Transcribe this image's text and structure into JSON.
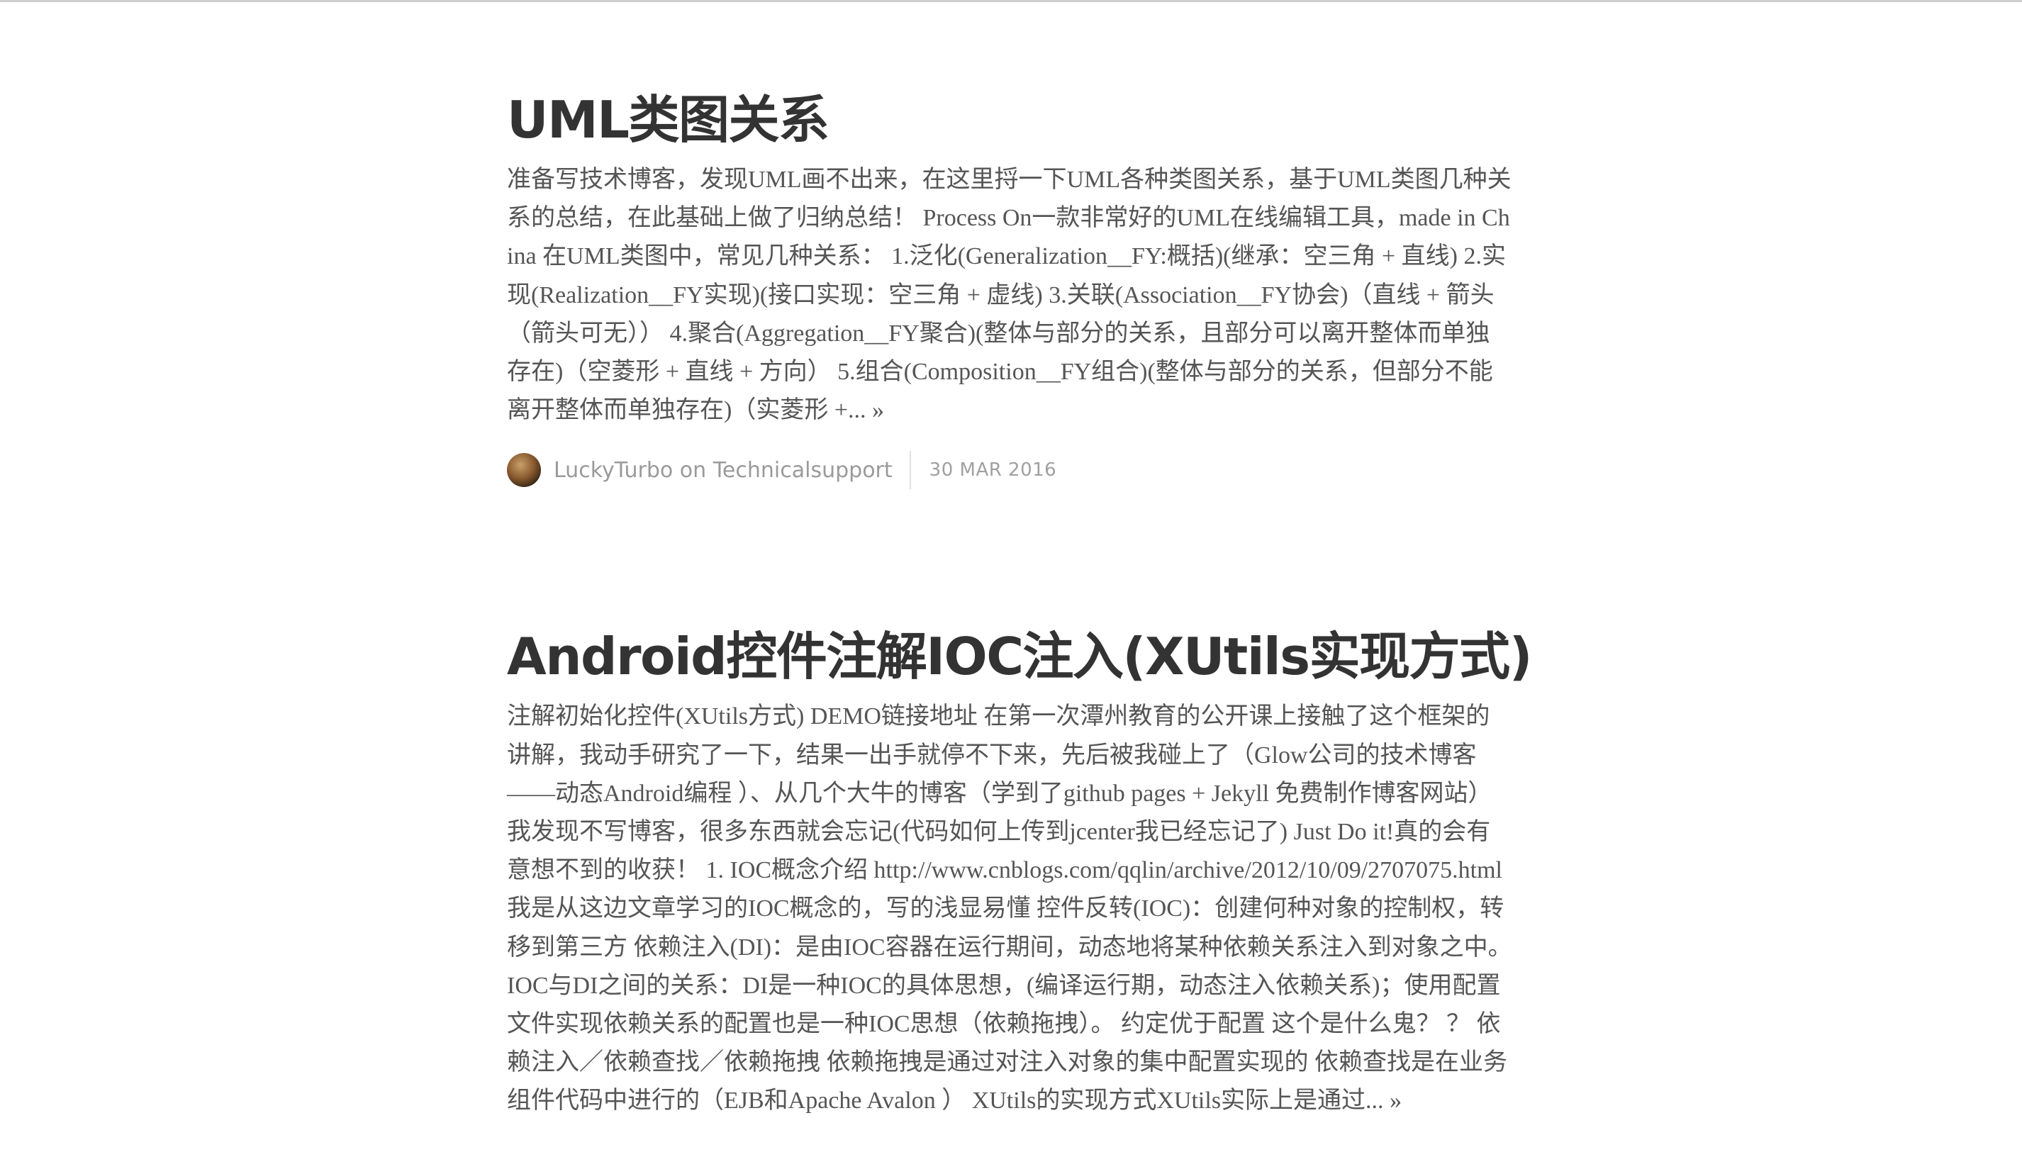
{
  "posts": [
    {
      "title": "UML类图关系",
      "excerpt": "准备写技术博客，发现UML画不出来，在这里捋一下UML各种类图关系，基于UML类图几种关系的总结，在此基础上做了归纳总结！ Process On一款非常好的UML在线编辑工具，made in China 在UML类图中，常见几种关系： 1.泛化(Generalization__FY:概括)(继承：空三角 + 直线) 2.实现(Realization__FY实现)(接口实现：空三角 + 虚线) 3.关联(Association__FY协会)（直线 + 箭头（箭头可无）） 4.聚合(Aggregation__FY聚合)(整体与部分的关系，且部分可以离开整体而单独存在)（空菱形 + 直线 + 方向） 5.组合(Composition__FY组合)(整体与部分的关系，但部分不能离开整体而单独存在)（实菱形 +... ",
      "read_more": "»",
      "author": "LuckyTurbo on Technicalsupport",
      "date": "30 MAR 2016"
    },
    {
      "title": "Android控件注解IOC注入(XUtils实现方式)",
      "excerpt": "注解初始化控件(XUtils方式) DEMO链接地址 在第一次潭州教育的公开课上接触了这个框架的讲解，我动手研究了一下，结果一出手就停不下来，先后被我碰上了（Glow公司的技术博客——动态Android编程 ）、从几个大牛的博客（学到了github pages + Jekyll 免费制作博客网站） 我发现不写博客，很多东西就会忘记(代码如何上传到jcenter我已经忘记了) Just Do it!真的会有意想不到的收获！ 1. IOC概念介绍 http://www.cnblogs.com/qqlin/archive/2012/10/09/2707075.html我是从这边文章学习的IOC概念的，写的浅显易懂 控件反转(IOC)：创建何种对象的控制权，转移到第三方 依赖注入(DI)：是由IOC容器在运行期间，动态地将某种依赖关系注入到对象之中。 IOC与DI之间的关系：DI是一种IOC的具体思想，(编译运行期，动态注入依赖关系)；使用配置文件实现依赖关系的配置也是一种IOC思想（依赖拖拽）。 约定优于配置 这个是什么鬼？ ？ 依赖注入／依赖查找／依赖拖拽 依赖拖拽是通过对注入对象的集中配置实现的 依赖查找是在业务组件代码中进行的（EJB和Apache Avalon ） XUtils的实现方式XUtils实际上是通过... ",
      "read_more": "»"
    }
  ]
}
